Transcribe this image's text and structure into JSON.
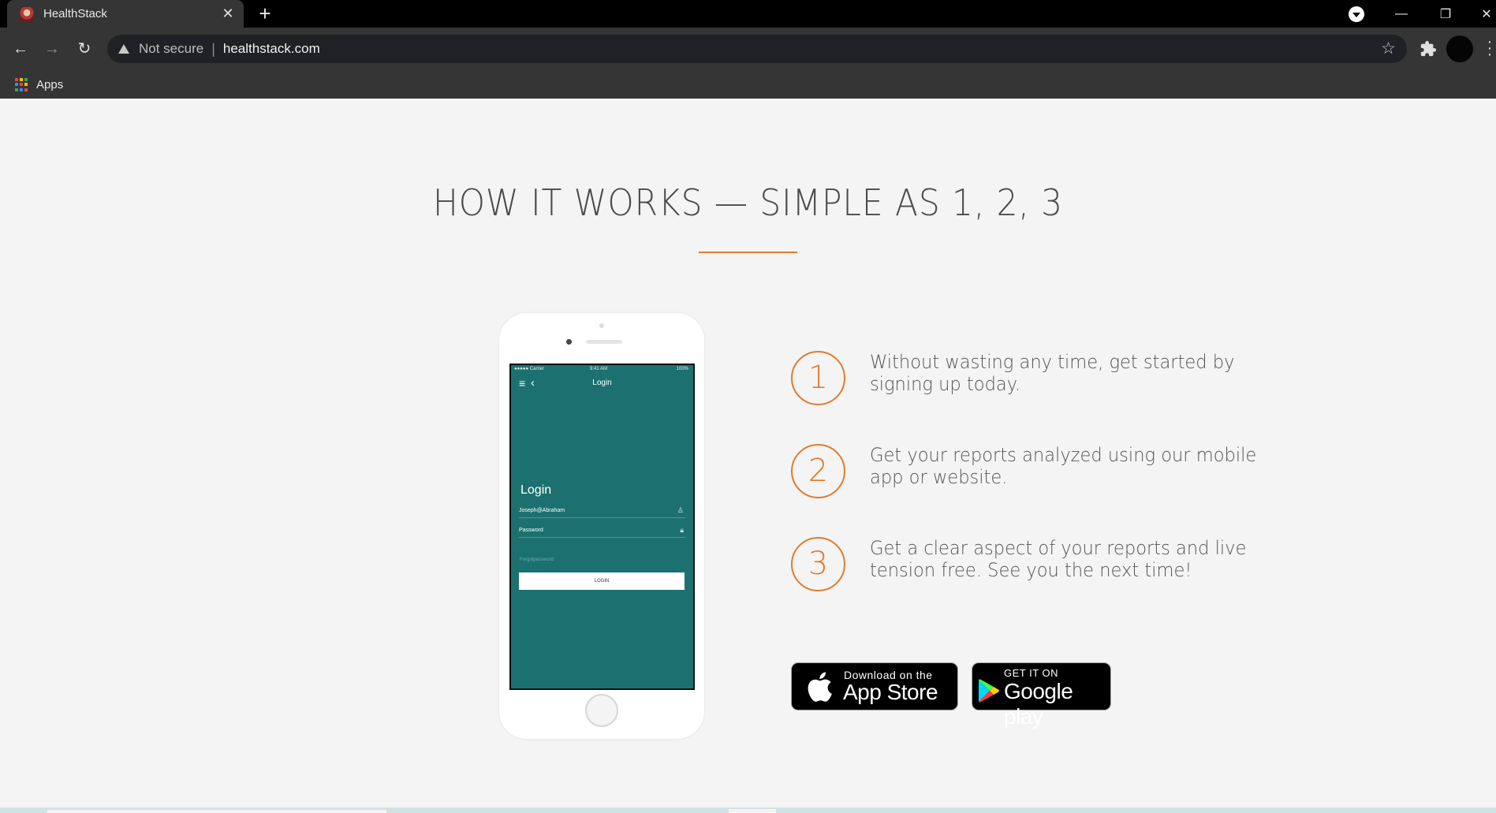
{
  "browser": {
    "tab_title": "HealthStack",
    "tab_close": "✕",
    "new_tab": "+",
    "not_secure": "Not secure",
    "url": "healthstack.com",
    "bookmarks": [
      {
        "label": "Apps"
      }
    ],
    "window_controls": {
      "minimize": "—",
      "restore": "❐",
      "close": "✕"
    }
  },
  "page": {
    "headline": "HOW IT WORKS — SIMPLE AS 1, 2, 3",
    "accent_color": "#e07b2e",
    "phone_screen": {
      "carrier": "●●●●● Carrier",
      "time": "9:41 AM",
      "battery": "100%",
      "nav_title": "Login",
      "login_title": "Login",
      "username_value": "Joseph@Abraham",
      "password_label": "Password",
      "forgot_label": "Forgotpassword",
      "login_button": "LOGIN",
      "screen_color": "#1c7170"
    },
    "steps": [
      {
        "number": "1",
        "text": "Without wasting any time, get started by signing up today."
      },
      {
        "number": "2",
        "text": "Get your reports analyzed using our mobile app or website."
      },
      {
        "number": "3",
        "text": "Get a clear aspect of your reports and live tension free. See you the next time!"
      }
    ],
    "badges": {
      "apple": {
        "small": "Download on the",
        "big": "App Store"
      },
      "google": {
        "small": "GET IT ON",
        "big": "Google play"
      }
    }
  }
}
